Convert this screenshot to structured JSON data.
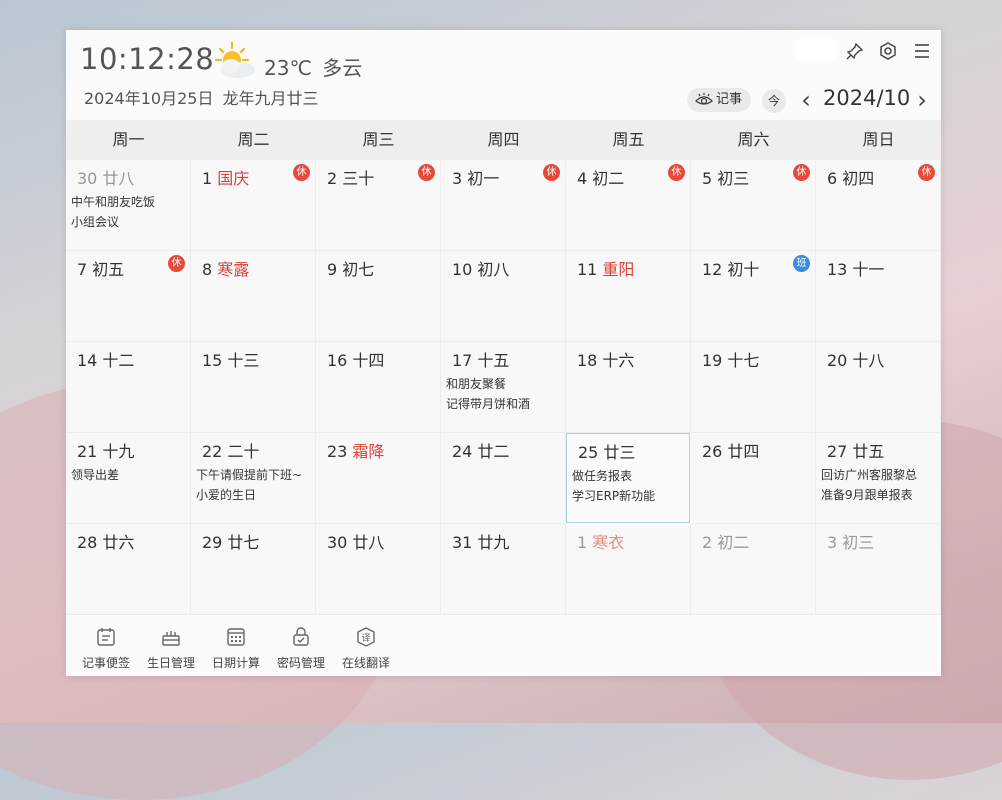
{
  "header": {
    "time": "10:12:28",
    "weather": {
      "temp": "23℃",
      "condition": "多云",
      "icon": "partly-cloudy-icon"
    },
    "date": "2024年10月25日",
    "lunar_date": "龙年九月廿三",
    "notes_label": "记事",
    "today_label": "今",
    "year_month": "2024/10"
  },
  "weekdays": [
    "周一",
    "周二",
    "周三",
    "周四",
    "周五",
    "周六",
    "周日"
  ],
  "weeks": [
    [
      {
        "num": "30",
        "lunar": "廿八",
        "dim": true,
        "events": [
          "中午和朋友吃饭",
          "小组会议"
        ]
      },
      {
        "num": "1",
        "lunar": "国庆",
        "red": true,
        "badge": "休"
      },
      {
        "num": "2",
        "lunar": "三十",
        "badge": "休"
      },
      {
        "num": "3",
        "lunar": "初一",
        "badge": "休"
      },
      {
        "num": "4",
        "lunar": "初二",
        "badge": "休"
      },
      {
        "num": "5",
        "lunar": "初三",
        "badge": "休"
      },
      {
        "num": "6",
        "lunar": "初四",
        "badge": "休"
      }
    ],
    [
      {
        "num": "7",
        "lunar": "初五",
        "badge": "休"
      },
      {
        "num": "8",
        "lunar": "寒露",
        "red": true
      },
      {
        "num": "9",
        "lunar": "初七"
      },
      {
        "num": "10",
        "lunar": "初八"
      },
      {
        "num": "11",
        "lunar": "重阳",
        "red": true
      },
      {
        "num": "12",
        "lunar": "初十",
        "badge": "班",
        "badge_type": "work"
      },
      {
        "num": "13",
        "lunar": "十一"
      }
    ],
    [
      {
        "num": "14",
        "lunar": "十二"
      },
      {
        "num": "15",
        "lunar": "十三"
      },
      {
        "num": "16",
        "lunar": "十四"
      },
      {
        "num": "17",
        "lunar": "十五",
        "events": [
          "和朋友聚餐",
          "记得带月饼和酒"
        ]
      },
      {
        "num": "18",
        "lunar": "十六"
      },
      {
        "num": "19",
        "lunar": "十七"
      },
      {
        "num": "20",
        "lunar": "十八"
      }
    ],
    [
      {
        "num": "21",
        "lunar": "十九",
        "events": [
          "领导出差"
        ]
      },
      {
        "num": "22",
        "lunar": "二十",
        "events": [
          "下午请假提前下班~",
          "小爱的生日"
        ]
      },
      {
        "num": "23",
        "lunar": "霜降",
        "red": true
      },
      {
        "num": "24",
        "lunar": "廿二"
      },
      {
        "num": "25",
        "lunar": "廿三",
        "selected": true,
        "events": [
          "做任务报表",
          "学习ERP新功能"
        ]
      },
      {
        "num": "26",
        "lunar": "廿四"
      },
      {
        "num": "27",
        "lunar": "廿五",
        "events": [
          "回访广州客服黎总",
          "准备9月跟单报表"
        ]
      }
    ],
    [
      {
        "num": "28",
        "lunar": "廿六"
      },
      {
        "num": "29",
        "lunar": "廿七"
      },
      {
        "num": "30",
        "lunar": "廿八"
      },
      {
        "num": "31",
        "lunar": "廿九"
      },
      {
        "num": "1",
        "lunar": "寒衣",
        "red": true,
        "dim": true
      },
      {
        "num": "2",
        "lunar": "初二",
        "dim": true
      },
      {
        "num": "3",
        "lunar": "初三",
        "dim": true
      }
    ]
  ],
  "footer_tools": [
    {
      "label": "记事便签",
      "icon": "notepad-icon"
    },
    {
      "label": "生日管理",
      "icon": "cake-icon"
    },
    {
      "label": "日期计算",
      "icon": "calendar-grid-icon"
    },
    {
      "label": "密码管理",
      "icon": "lock-icon"
    },
    {
      "label": "在线翻译",
      "icon": "translate-icon"
    }
  ],
  "colors": {
    "holiday_red": "#d9423a",
    "rest_badge": "#e64a3b",
    "work_badge": "#3a8ce0",
    "selected_border": "#a9d2ea"
  }
}
